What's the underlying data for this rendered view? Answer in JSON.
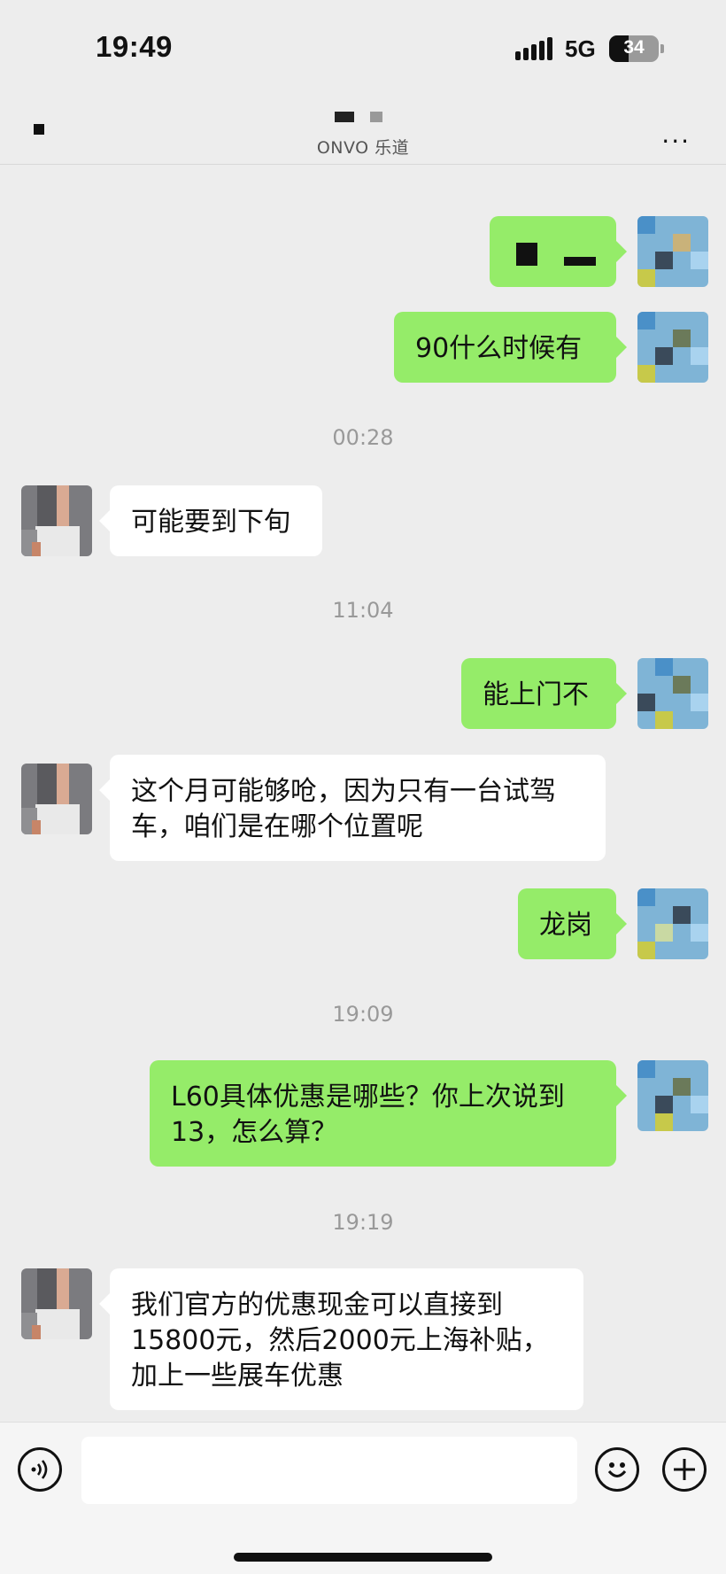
{
  "status": {
    "time": "19:49",
    "network": "5G",
    "battery": "34"
  },
  "header": {
    "subtitle": "ONVO 乐道",
    "more": "..."
  },
  "messages": {
    "m1": "90什么时候有",
    "t1": "00:28",
    "m2": "可能要到下旬",
    "t2": "11:04",
    "m3": "能上门不",
    "m4_line1": "这个月可能够呛，因为只有一台试驾",
    "m4_line2": "车，咱们是在哪个位置呢",
    "m5": "龙岗",
    "t3": "19:09",
    "m6_line1": "L60具体优惠是哪些？你上次说到",
    "m6_line2": "13，怎么算？",
    "t4": "19:19",
    "m7_line1": "我们官方的优惠现金可以直接到",
    "m7_line2": "15800元，然后2000元上海补贴，",
    "m7_line3": "加上一些展车优惠"
  },
  "input": {
    "value": ""
  },
  "icons": {
    "voice": "voice-icon",
    "emoji": "emoji-icon",
    "plus": "plus-icon",
    "back": "back-icon",
    "more": "more-icon"
  },
  "colors": {
    "out_bubble": "#95ec69",
    "in_bubble": "#ffffff",
    "background": "#ededed"
  }
}
